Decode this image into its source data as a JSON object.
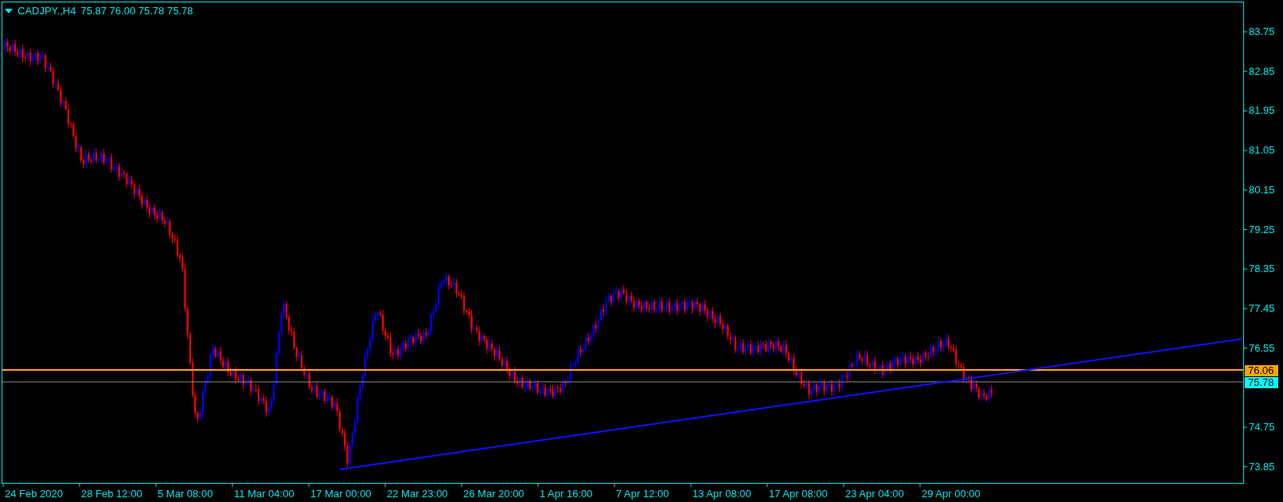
{
  "header": {
    "symbol": "CADJPY.,H4",
    "ohlc": "75.87 76.00 75.78 75.78"
  },
  "price_axis": {
    "labels": [
      "83.75",
      "82.85",
      "81.95",
      "81.05",
      "80.15",
      "79.25",
      "78.35",
      "77.45",
      "76.55",
      "74.75",
      "73.85"
    ]
  },
  "price_tags": [
    {
      "kind": "level",
      "text": "76.06"
    },
    {
      "kind": "bid",
      "text": "75.78"
    }
  ],
  "time_axis": {
    "labels": [
      "24 Feb 2020",
      "28 Feb 12:00",
      "5 Mar 08:00",
      "11 Mar 04:00",
      "17 Mar 00:00",
      "22 Mar 23:00",
      "26 Mar 20:00",
      "1 Apr 16:00",
      "7 Apr 12:00",
      "13 Apr 08:00",
      "17 Apr 08:00",
      "23 Apr 04:00",
      "29 Apr 00:00"
    ]
  }
}
